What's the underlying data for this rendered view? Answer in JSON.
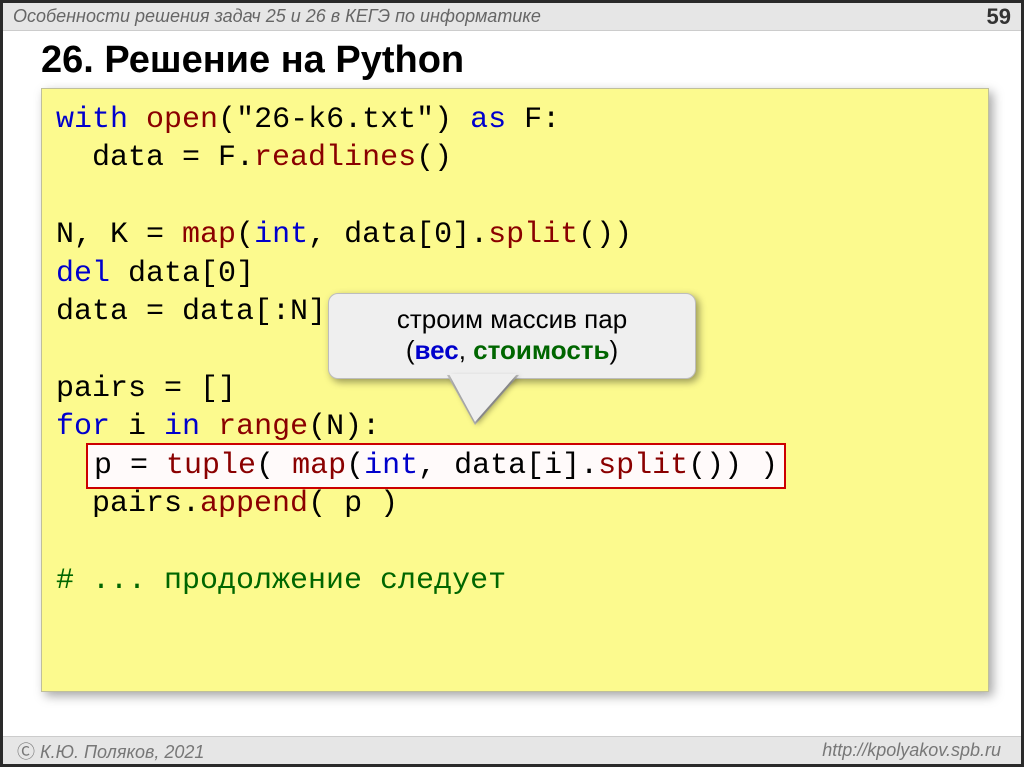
{
  "topbar": {
    "title": "Особенности решения задач 25 и 26 в КЕГЭ по информатике",
    "slide_number": "59"
  },
  "heading": "26. Решение на Python",
  "code": {
    "l1a": "with",
    "l1b": " ",
    "l1c": "open",
    "l1d": "(",
    "l1e": "\"26-k6.txt\"",
    "l1f": ")",
    "l1g": " ",
    "l1h": "as",
    "l1i": " F:",
    "l2a": "  data = F.",
    "l2b": "readlines",
    "l2c": "()",
    "blank1": "",
    "l3a": "N, K = ",
    "l3b": "map",
    "l3c": "(",
    "l3d": "int",
    "l3e": ", data[",
    "l3f": "0",
    "l3g": "].",
    "l3h": "split",
    "l3i": "())",
    "l4a": "del",
    "l4b": " data[",
    "l4c": "0",
    "l4d": "]",
    "l5a": "data = data[:N]",
    "blank2": "",
    "l6a": "pairs = []",
    "l7a": "for",
    "l7b": " i ",
    "l7c": "in",
    "l7d": " ",
    "l7e": "range",
    "l7f": "(N):",
    "l8pre": "  ",
    "l8a": "p = ",
    "l8b": "tuple",
    "l8c": "( ",
    "l8d": "map",
    "l8e": "(",
    "l8f": "int",
    "l8g": ", data[i].",
    "l8h": "split",
    "l8i": "()) )",
    "l9a": "  pairs.",
    "l9b": "append",
    "l9c": "( p )",
    "blank3": "",
    "l10a": "# ... продолжение следует"
  },
  "callout": {
    "line1": "строим массив пар",
    "lp": "(",
    "ves": "вес",
    "sep": ", ",
    "cost": "стоимость",
    "rp": ")"
  },
  "footer": {
    "copyright": " К.Ю. Поляков, 2021",
    "url": "http://kpolyakov.spb.ru"
  }
}
